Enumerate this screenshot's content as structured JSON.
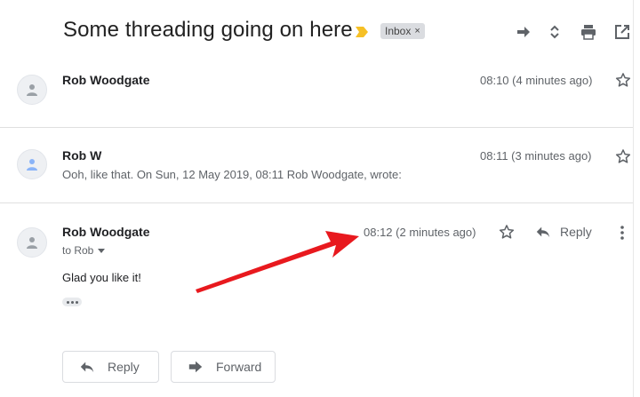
{
  "thread": {
    "subject": "Some threading going on here",
    "label": "Inbox",
    "label_remove": "×"
  },
  "messages": [
    {
      "sender": "Rob Woodgate",
      "time": "08:10 (4 minutes ago)",
      "snippet": "",
      "avatar_color": "#9aa0a6"
    },
    {
      "sender": "Rob W",
      "time": "08:11 (3 minutes ago)",
      "snippet": "Ooh, like that. On Sun, 12 May 2019, 08:11 Rob Woodgate, wrote:",
      "avatar_color": "#8ab4f8"
    },
    {
      "sender": "Rob Woodgate",
      "time": "08:12 (2 minutes ago)",
      "to": "to Rob",
      "body": "Glad you like it!",
      "reply_label": "Reply",
      "avatar_color": "#9aa0a6"
    }
  ],
  "actions": {
    "reply_label": "Reply",
    "forward_label": "Forward"
  },
  "colors": {
    "importance": "#f6c026",
    "annotation_arrow": "#e8191e"
  }
}
